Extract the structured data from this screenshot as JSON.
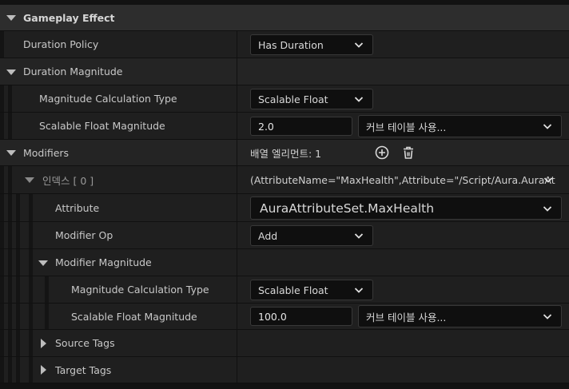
{
  "header": {
    "title": "Gameplay Effect"
  },
  "duration_policy": {
    "label": "Duration Policy",
    "value": "Has Duration"
  },
  "duration_magnitude": {
    "label": "Duration Magnitude",
    "calc_type": {
      "label": "Magnitude Calculation Type",
      "value": "Scalable Float"
    },
    "scalable_float": {
      "label": "Scalable Float Magnitude",
      "value": "2.0",
      "curve_placeholder": "커브 테이블 사용..."
    }
  },
  "modifiers": {
    "label": "Modifiers",
    "array_elements": "배열 엘리먼트: 1",
    "index": {
      "label": "인덱스 [ 0 ]",
      "summary": "(AttributeName=\"MaxHealth\",Attribute=\"/Script/Aura.AuraAt",
      "attribute": {
        "label": "Attribute",
        "value": "AuraAttributeSet.MaxHealth"
      },
      "modifier_op": {
        "label": "Modifier Op",
        "value": "Add"
      },
      "modifier_magnitude": {
        "label": "Modifier Magnitude",
        "calc_type": {
          "label": "Magnitude Calculation Type",
          "value": "Scalable Float"
        },
        "scalable_float": {
          "label": "Scalable Float Magnitude",
          "value": "100.0",
          "curve_placeholder": "커브 테이블 사용..."
        }
      },
      "source_tags": {
        "label": "Source Tags"
      },
      "target_tags": {
        "label": "Target Tags"
      }
    }
  },
  "icons": {
    "add": "plus-circle-icon",
    "delete": "trash-icon"
  }
}
